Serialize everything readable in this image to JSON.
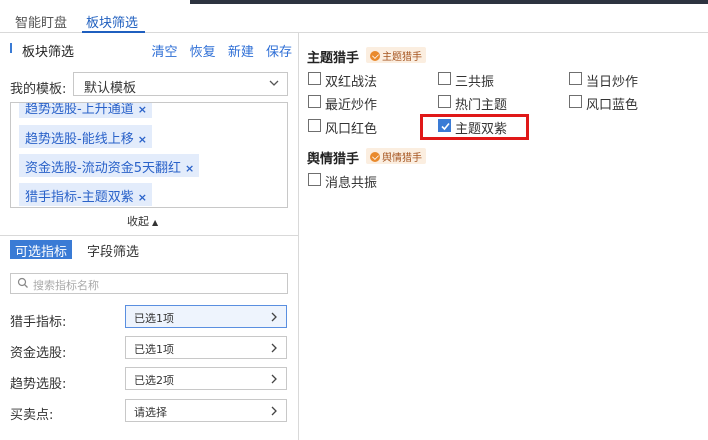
{
  "tabs": [
    "智能盯盘",
    "板块筛选"
  ],
  "left": {
    "section_title": "板块筛选",
    "actions": [
      "清空",
      "恢复",
      "新建",
      "保存"
    ],
    "template_label": "我的模板:",
    "template_value": "默认模板",
    "tags": [
      "趋势选股-上升通道",
      "趋势选股-能线上移",
      "资金选股-流动资金5天翻红",
      "猎手指标-主题双紫"
    ],
    "collapse_label": "收起",
    "subtabs": [
      "可选指标",
      "字段筛选"
    ],
    "search_placeholder": "搜索指标名称",
    "filters": [
      {
        "label": "猎手指标:",
        "value": "已选1项"
      },
      {
        "label": "资金选股:",
        "value": "已选1项"
      },
      {
        "label": "趋势选股:",
        "value": "已选2项"
      },
      {
        "label": "买卖点:",
        "value": "请选择"
      }
    ]
  },
  "right": {
    "groups": [
      {
        "title": "主题猎手",
        "badge": "主题猎手",
        "options": [
          {
            "label": "双红战法",
            "checked": false
          },
          {
            "label": "三共振",
            "checked": false
          },
          {
            "label": "当日炒作",
            "checked": false
          },
          {
            "label": "最近炒作",
            "checked": false
          },
          {
            "label": "热门主题",
            "checked": false
          },
          {
            "label": "风口蓝色",
            "checked": false
          },
          {
            "label": "风口红色",
            "checked": false
          },
          {
            "label": "主题双紫",
            "checked": true
          }
        ]
      },
      {
        "title": "舆情猎手",
        "badge": "舆情猎手",
        "options": [
          {
            "label": "消息共振",
            "checked": false
          }
        ]
      }
    ]
  },
  "colors": {
    "accent": "#3a7bd5",
    "highlight": "#e01818",
    "tag_bg": "#e3ecfb",
    "badge_bg": "#fbeee0"
  }
}
